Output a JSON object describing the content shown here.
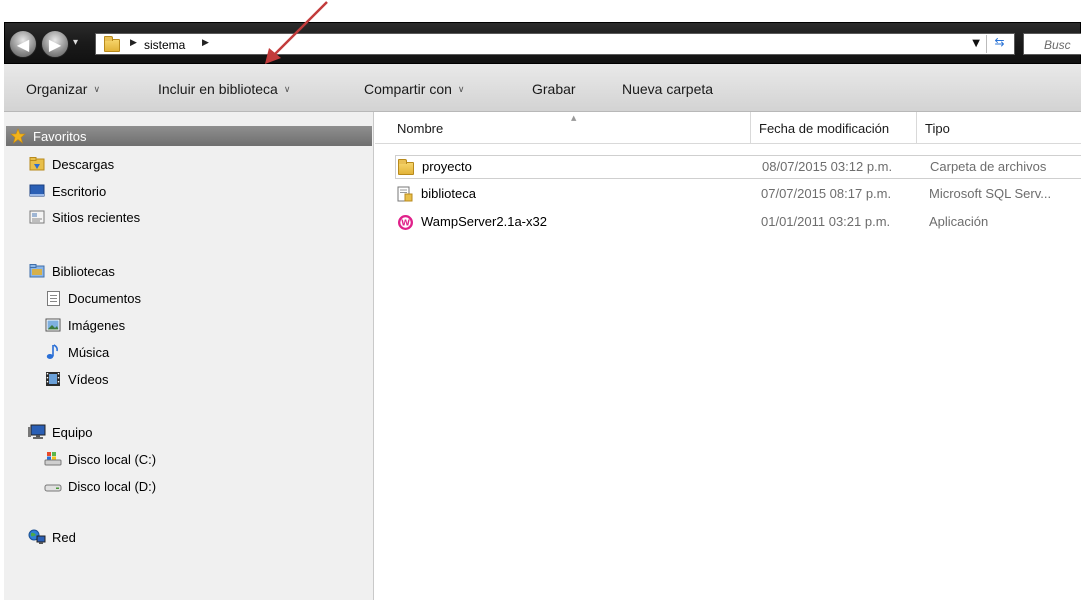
{
  "address_bar": {
    "breadcrumb": [
      "sistema"
    ],
    "search_placeholder": "Busc"
  },
  "toolbar": {
    "organizar": "Organizar",
    "incluir": "Incluir en biblioteca",
    "compartir": "Compartir con",
    "grabar": "Grabar",
    "nueva_carpeta": "Nueva carpeta"
  },
  "nav": {
    "favoritos": "Favoritos",
    "descargas": "Descargas",
    "escritorio": "Escritorio",
    "sitios_recientes": "Sitios recientes",
    "bibliotecas": "Bibliotecas",
    "documentos": "Documentos",
    "imagenes": "Imágenes",
    "musica": "Música",
    "videos": "Vídeos",
    "equipo": "Equipo",
    "disco_c": "Disco local (C:)",
    "disco_d": "Disco local (D:)",
    "red": "Red"
  },
  "columns": {
    "nombre": "Nombre",
    "fecha": "Fecha de modificación",
    "tipo": "Tipo"
  },
  "files": [
    {
      "name": "proyecto",
      "date": "08/07/2015 03:12 p.m.",
      "type": "Carpeta de archivos",
      "icon": "folder-icon"
    },
    {
      "name": "biblioteca",
      "date": "07/07/2015 08:17 p.m.",
      "type": "Microsoft SQL Serv...",
      "icon": "sql-file-icon"
    },
    {
      "name": "WampServer2.1a-x32",
      "date": "01/01/2011 03:21 p.m.",
      "type": "Aplicación",
      "icon": "wampserver-icon"
    }
  ],
  "colors": {
    "annotation_arrow": "#c23b3b",
    "selected_nav": "#7a7a7a",
    "wamp": "#e0218a"
  }
}
